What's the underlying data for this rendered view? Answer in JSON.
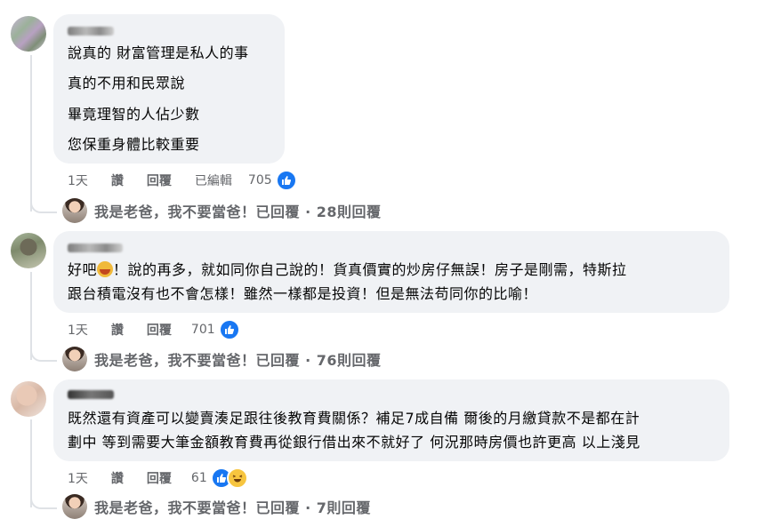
{
  "comments": [
    {
      "lines": [
        "說真的 財富管理是私人的事",
        "真的不用和民眾說",
        "畢竟理智的人佔少數",
        "您保重身體比較重要"
      ],
      "time": "1天",
      "like_label": "讚",
      "reply_label": "回覆",
      "edited_label": "已編輯",
      "reaction_count": "705",
      "reply_summary": "我是老爸，我不要當爸！已回覆 · 28則回覆"
    },
    {
      "lines": [
        "好吧",
        "！說的再多，就如同你自己說的！貨真價實的炒房仔無誤！房子是剛需，特斯拉",
        "跟台積電沒有也不會怎樣！雖然一樣都是投資！但是無法苟同你的比喻！"
      ],
      "time": "1天",
      "like_label": "讚",
      "reply_label": "回覆",
      "reaction_count": "701",
      "reply_summary": "我是老爸，我不要當爸！已回覆 · 76則回覆"
    },
    {
      "lines": [
        "既然還有資產可以變賣湊足跟往後教育費關係？補足7成自備 爾後的月繳貸款不是都在計",
        "劃中 等到需要大筆金額教育費再從銀行借出來不就好了 何況那時房價也許更高 以上淺見"
      ],
      "time": "1天",
      "like_label": "讚",
      "reply_label": "回覆",
      "reaction_count": "61",
      "reply_summary": "我是老爸，我不要當爸！已回覆 · 7則回覆"
    }
  ],
  "icons": {
    "like": "thumbs-up-icon",
    "haha": "haha-emoji-icon",
    "facepalm": "facepalm-emoji-icon"
  },
  "colors": {
    "bubble": "#f0f2f5",
    "like_blue": "#1877f2",
    "meta_gray": "#65676b"
  }
}
